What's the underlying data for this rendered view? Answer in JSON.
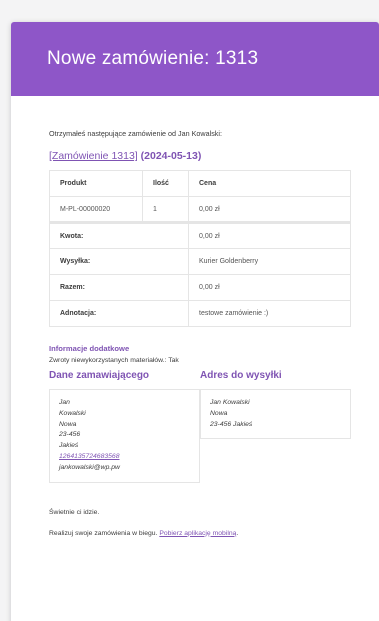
{
  "header": {
    "title": "Nowe zamówienie: 1313"
  },
  "intro": "Otrzymałeś następujące zamówienie od Jan Kowalski:",
  "order": {
    "link_text": "[Zamówienie 1313]",
    "date": "(2024-05-13)"
  },
  "table": {
    "headers": [
      "Produkt",
      "Ilość",
      "Cena"
    ],
    "rows": [
      {
        "product": "M-PL-00000020",
        "qty": "1",
        "price": "0,00 zł"
      }
    ],
    "totals": [
      {
        "label": "Kwota:",
        "value": "0,00 zł"
      },
      {
        "label": "Wysyłka:",
        "value": "Kurier Goldenberry"
      },
      {
        "label": "Razem:",
        "value": "0,00 zł"
      },
      {
        "label": "Adnotacja:",
        "value": "testowe zamówienie :)"
      }
    ]
  },
  "extra": {
    "title": "Informacje dodatkowe",
    "line": "Zwroty niewykorzystanych materiałów.: Tak"
  },
  "billing": {
    "title": "Dane zamawiającego",
    "lines": [
      "Jan",
      "Kowalski",
      "Nowa",
      "23-456",
      "Jakieś"
    ],
    "phone": "1264135724683568",
    "email": "jankowalski@wp.pw"
  },
  "shipping": {
    "title": "Adres do wysyłki",
    "lines": [
      "Jan Kowalski",
      "Nowa",
      "23-456 Jakieś"
    ]
  },
  "footer": {
    "line1": "Świetnie ci idzie.",
    "line2_prefix": "Realizuj swoje zamówienia w biegu. ",
    "line2_link": "Pobierz aplikację mobilną",
    "line2_suffix": "."
  },
  "colors": {
    "accent": "#8e56c8",
    "link": "#7f54b3",
    "border": "#e5e5e5"
  }
}
